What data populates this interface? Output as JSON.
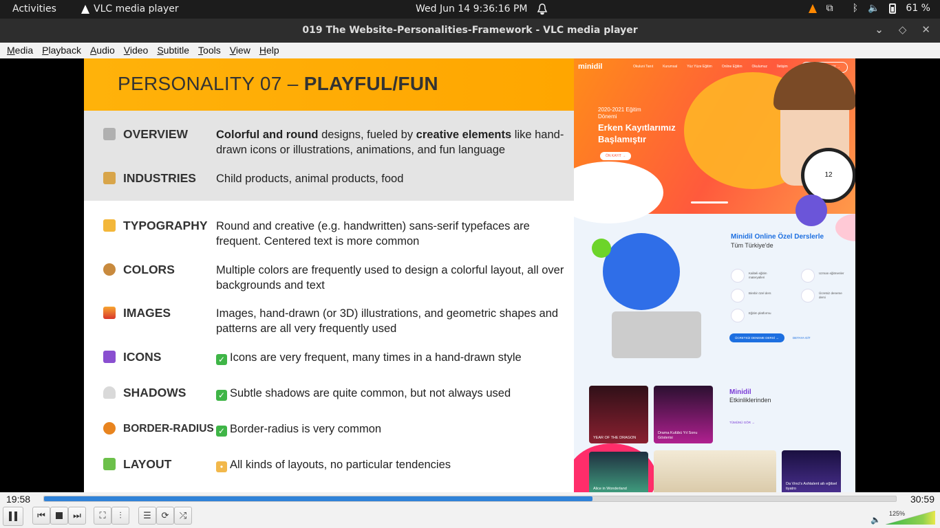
{
  "topbar": {
    "activities": "Activities",
    "app_name": "VLC media player",
    "clock": "Wed Jun 14   9:36:16 PM",
    "battery": "61 %"
  },
  "window": {
    "title": "019 The Website-Personalities-Framework - VLC media player"
  },
  "menu": [
    "Media",
    "Playback",
    "Audio",
    "Video",
    "Subtitle",
    "Tools",
    "View",
    "Help"
  ],
  "slide": {
    "title_prefix": "PERSONALITY 07 – ",
    "title_bold": "PLAYFUL/FUN",
    "rows": [
      {
        "label": "OVERVIEW",
        "desc_b1": "Colorful and round",
        "desc_t1": " designs, fueled by ",
        "desc_b2": "creative elements",
        "desc_t2": " like hand-drawn icons or illustrations, animations, and fun language",
        "emoji_color": "#a9a9a9"
      },
      {
        "label": "INDUSTRIES",
        "desc": "Child products, animal products, food",
        "emoji_color": "#d8a54a"
      },
      {
        "label": "TYPOGRAPHY",
        "desc": "Round and creative (e.g. handwritten) sans-serif typefaces are frequent. Centered text is more common",
        "emoji_color": "#f3b73a"
      },
      {
        "label": "COLORS",
        "desc": "Multiple colors are frequently used to design a colorful layout, all over backgrounds and text",
        "emoji_color": "#c88a3e"
      },
      {
        "label": "IMAGES",
        "desc": "Images, hand-drawn (or 3D) illustrations, and geometric shapes and patterns are all very frequently used",
        "emoji_color": "#e0572b"
      },
      {
        "label": "ICONS",
        "desc": "Icons are very frequent, many times in a hand-drawn style",
        "emoji_color": "#8a4fd0",
        "check": true
      },
      {
        "label": "SHADOWS",
        "desc": "Subtle shadows are quite common, but not always used",
        "emoji_color": "#cfcfcf",
        "check": true
      },
      {
        "label": "BORDER-RADIUS",
        "desc": "Border-radius is very common",
        "emoji_color": "#e8841f",
        "check": true
      },
      {
        "label": "LAYOUT",
        "desc": "All kinds of layouts, no particular tendencies",
        "emoji_color": "#6cc04a"
      }
    ]
  },
  "site": {
    "logo": "minidil",
    "nav": [
      "Okuluni Tanıt",
      "Kurumsal",
      "Yüz Yüze Eğitim",
      "Online Eğitim",
      "Okulumuz",
      "İletişim"
    ],
    "cta": "PLATFORMA GİT →",
    "hero_sub": "2020-2021 Eğitim Dönemi",
    "hero_title": "Erken Kayıtlarımız Başlamıştır",
    "hero_btn": "ÖN KAYIT →",
    "sec2_title": "Minidil Online Özel Derslerle",
    "sec2_sub": "Tüm Türkiye'de",
    "features": [
      "Kaliteli eğitim materyalleri",
      "Uzman eğitmenler",
      "Birebir özel ders",
      "Ücretsiz deneme dersi",
      "Eğitim platformu"
    ],
    "btn2": "ÜCRETSİZ DENEME DERSİ →",
    "link2": "DETAYA GİT",
    "events_title": "Minidil",
    "events_sub": "Etkinliklerinden",
    "events_link": "TÜMÜNÜ GÖR →",
    "cards": [
      "YEAR OF THE DRAGON",
      "Drama Kulübü Yıl Sonu Gösterisi",
      "Alice in Wonderland",
      "Da Vinci's Ashtalent ailı eğitsel tiyatro"
    ],
    "clock_num": "12"
  },
  "player": {
    "elapsed": "19:58",
    "total": "30:59",
    "progress": 0.644,
    "volume": "125%"
  }
}
